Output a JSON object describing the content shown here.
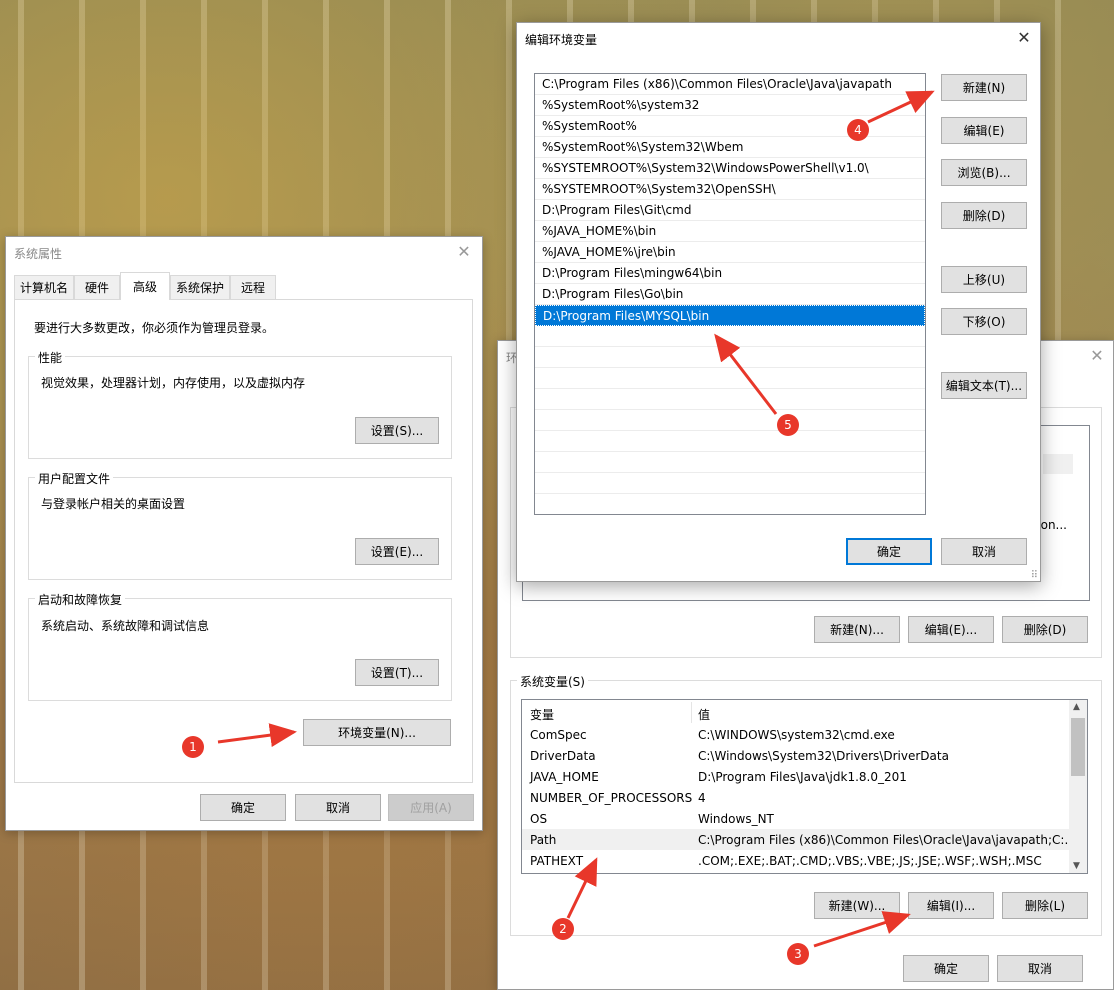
{
  "sysprops": {
    "title": "系统属性",
    "tabs": [
      "计算机名",
      "硬件",
      "高级",
      "系统保护",
      "远程"
    ],
    "admin_note": "要进行大多数更改，你必须作为管理员登录。",
    "perf": {
      "label": "性能",
      "desc": "视觉效果，处理器计划，内存使用，以及虚拟内存",
      "button": "设置(S)..."
    },
    "profile": {
      "label": "用户配置文件",
      "desc": "与登录帐户相关的桌面设置",
      "button": "设置(E)..."
    },
    "startup": {
      "label": "启动和故障恢复",
      "desc": "系统启动、系统故障和调试信息",
      "button": "设置(T)..."
    },
    "env_button": "环境变量(N)...",
    "ok": "确定",
    "cancel": "取消",
    "apply": "应用(A)"
  },
  "envvars": {
    "title_partial": "环",
    "user_buttons": {
      "new": "新建(N)...",
      "edit": "编辑(E)...",
      "delete": "删除(D)"
    },
    "user_partial_text": "on...",
    "sys_label": "系统变量(S)",
    "col_var": "变量",
    "col_val": "值",
    "rows": [
      {
        "name": "ComSpec",
        "value": "C:\\WINDOWS\\system32\\cmd.exe"
      },
      {
        "name": "DriverData",
        "value": "C:\\Windows\\System32\\Drivers\\DriverData"
      },
      {
        "name": "JAVA_HOME",
        "value": "D:\\Program Files\\Java\\jdk1.8.0_201"
      },
      {
        "name": "NUMBER_OF_PROCESSORS",
        "value": "4"
      },
      {
        "name": "OS",
        "value": "Windows_NT"
      },
      {
        "name": "Path",
        "value": "C:\\Program Files (x86)\\Common Files\\Oracle\\Java\\javapath;C:..."
      },
      {
        "name": "PATHEXT",
        "value": ".COM;.EXE;.BAT;.CMD;.VBS;.VBE;.JS;.JSE;.WSF;.WSH;.MSC"
      }
    ],
    "sys_buttons": {
      "new": "新建(W)...",
      "edit": "编辑(I)...",
      "delete": "删除(L)"
    },
    "ok": "确定",
    "cancel": "取消"
  },
  "editenv": {
    "title": "编辑环境变量",
    "paths": [
      "C:\\Program Files (x86)\\Common Files\\Oracle\\Java\\javapath",
      "%SystemRoot%\\system32",
      "%SystemRoot%",
      "%SystemRoot%\\System32\\Wbem",
      "%SYSTEMROOT%\\System32\\WindowsPowerShell\\v1.0\\",
      "%SYSTEMROOT%\\System32\\OpenSSH\\",
      "D:\\Program Files\\Git\\cmd",
      "%JAVA_HOME%\\bin",
      "%JAVA_HOME%\\jre\\bin",
      "D:\\Program Files\\mingw64\\bin",
      "D:\\Program Files\\Go\\bin",
      "D:\\Program Files\\MYSQL\\bin"
    ],
    "selected_index": 11,
    "buttons": {
      "new": "新建(N)",
      "edit": "编辑(E)",
      "browse": "浏览(B)...",
      "delete": "删除(D)",
      "up": "上移(U)",
      "down": "下移(O)",
      "edit_text": "编辑文本(T)..."
    },
    "ok": "确定",
    "cancel": "取消"
  },
  "annotations": [
    "1",
    "2",
    "3",
    "4",
    "5"
  ],
  "colors": {
    "accent": "#0078d7",
    "annotation": "#e8372a"
  }
}
